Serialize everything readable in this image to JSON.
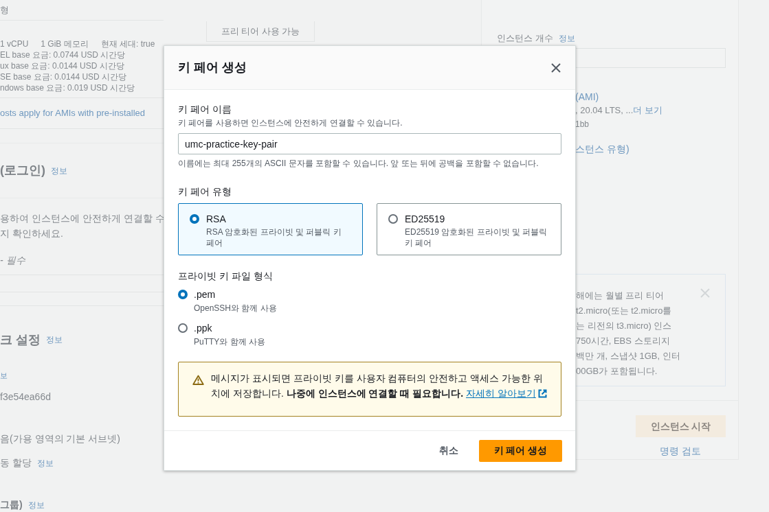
{
  "background": {
    "left": {
      "heading_fragment": "형",
      "free_tier_badge": "프리 티어 사용 가능",
      "specs": [
        "1 vCPU",
        "1 GiB 메모리",
        "현재 세대: true"
      ],
      "pricing": [
        "EL base 요금: 0.0744 USD 시간당",
        "ux base 요금: 0.0144 USD 시간당",
        "SE base 요금: 0.0144 USD 시간당",
        "ndows base 요금: 0.019 USD 시간당"
      ],
      "ami_cost_link": "osts apply for AMIs with pre-installed",
      "login_heading": "(로그인)",
      "login_info": "정보",
      "login_text": [
        "용하여 인스턴스에 안전하게 연결할 수",
        "지 확인하세요."
      ],
      "required_label": "- 필수",
      "network_heading": "크 설정",
      "network_info": "정보",
      "network_info_fragment": "보",
      "vpc_value": "f3e54ea66d",
      "subnet_value": "음(가용 영역의 기본 서브넷)",
      "public_ip_label": "동 할당",
      "public_ip_info": "정보",
      "security_heading": "그룹)",
      "security_info": "정보"
    },
    "right": {
      "count_label": "인스턴스 개수",
      "count_info": "정보",
      "ami_label": "(AMI)",
      "ami_value": ", 20.04 LTS, ...",
      "ami_more": "더 보기",
      "ami_id": "1bb",
      "instance_type_label": "스턴스 유형)",
      "free_tier_lines": [
        "해에는 월별 프리 티어",
        "t2.micro(또는 t2.micro를",
        "는 리전의 t3.micro) 인스",
        "750시간, EBS 스토리지",
        "백만 개, 스냅샷 1GB, 인터",
        "00GB가 포함됩니다."
      ],
      "launch_button": "인스턴스 시작",
      "review_link": "명령 검토"
    }
  },
  "modal": {
    "title": "키 페어 생성",
    "name_field": {
      "label": "키 페어 이름",
      "description": "키 페어를 사용하면 인스턴스에 안전하게 연결할 수 있습니다.",
      "value": "umc-practice-key-pair",
      "constraint": "이름에는 최대 255개의 ASCII 문자를 포함할 수 있습니다. 앞 또는 뒤에 공백을 포함할 수 없습니다."
    },
    "key_type": {
      "label": "키 페어 유형",
      "options": [
        {
          "label": "RSA",
          "description": "RSA 암호화된 프라이빗 및 퍼블릭 키 페어",
          "selected": true
        },
        {
          "label": "ED25519",
          "description": "ED25519 암호화된 프라이빗 및 퍼블릭 키 페어",
          "selected": false
        }
      ]
    },
    "file_format": {
      "label": "프라이빗 키 파일 형식",
      "options": [
        {
          "label": ".pem",
          "description": "OpenSSH와 함께 사용",
          "selected": true
        },
        {
          "label": ".ppk",
          "description": "PuTTY와 함께 사용",
          "selected": false
        }
      ]
    },
    "alert": {
      "text": "메시지가 표시되면 프라이빗 키를 사용자 컴퓨터의 안전하고 액세스 가능한 위치에 저장합니다. **나중에 인스턴스에 연결할 때 필요합니다.**",
      "link": "자세히 알아보기"
    },
    "cancel": "취소",
    "submit": "키 페어 생성"
  }
}
